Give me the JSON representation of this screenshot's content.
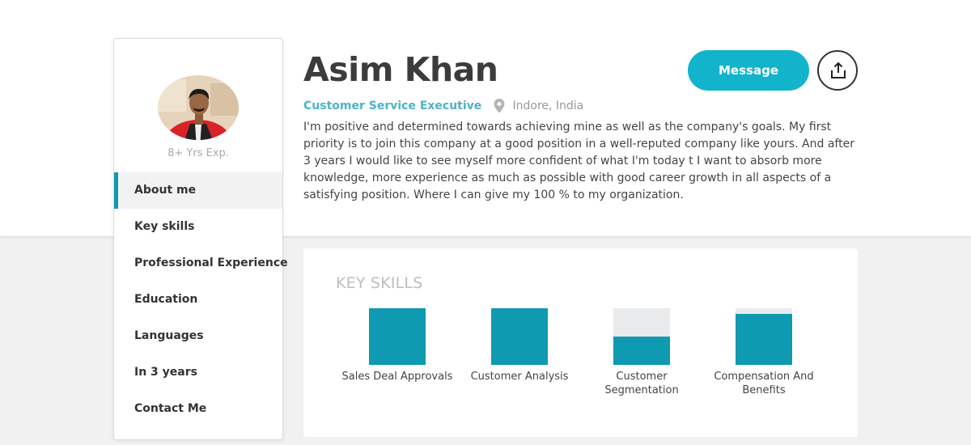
{
  "profile": {
    "name": "Asim Khan",
    "role": "Customer Service Executive",
    "location": "Indore, India",
    "experience": "8+ Yrs Exp.",
    "about": "I'm positive and determined towards achieving mine as well as the company's goals. My first priority is to join this company at a good position in a well-reputed company like yours. And after 3 years I would like to see myself more confident of what I'm today t I want to absorb more knowledge, more experience as much as possible with good career growth in all aspects of a satisfying position. Where I can give my 100 % to my organization."
  },
  "actions": {
    "message_label": "Message",
    "share_icon": "share-icon"
  },
  "sidebar": {
    "items": [
      {
        "label": "About me",
        "active": true
      },
      {
        "label": "Key skills"
      },
      {
        "label": "Professional Experience"
      },
      {
        "label": "Education"
      },
      {
        "label": "Languages"
      },
      {
        "label": "In 3 years"
      },
      {
        "label": "Contact Me"
      }
    ]
  },
  "skills": {
    "title": "KEY SKILLS",
    "items": [
      {
        "label": "Sales Deal Approvals",
        "level": 1.0
      },
      {
        "label": "Customer Analysis",
        "level": 1.0
      },
      {
        "label": "Customer Segmentation",
        "level": 0.5
      },
      {
        "label": "Compensation And Benefits",
        "level": 0.9
      }
    ]
  },
  "colors": {
    "accent": "#12b4cc",
    "skill_fill": "#0e9ab0",
    "role_text": "#4bb4c8"
  }
}
